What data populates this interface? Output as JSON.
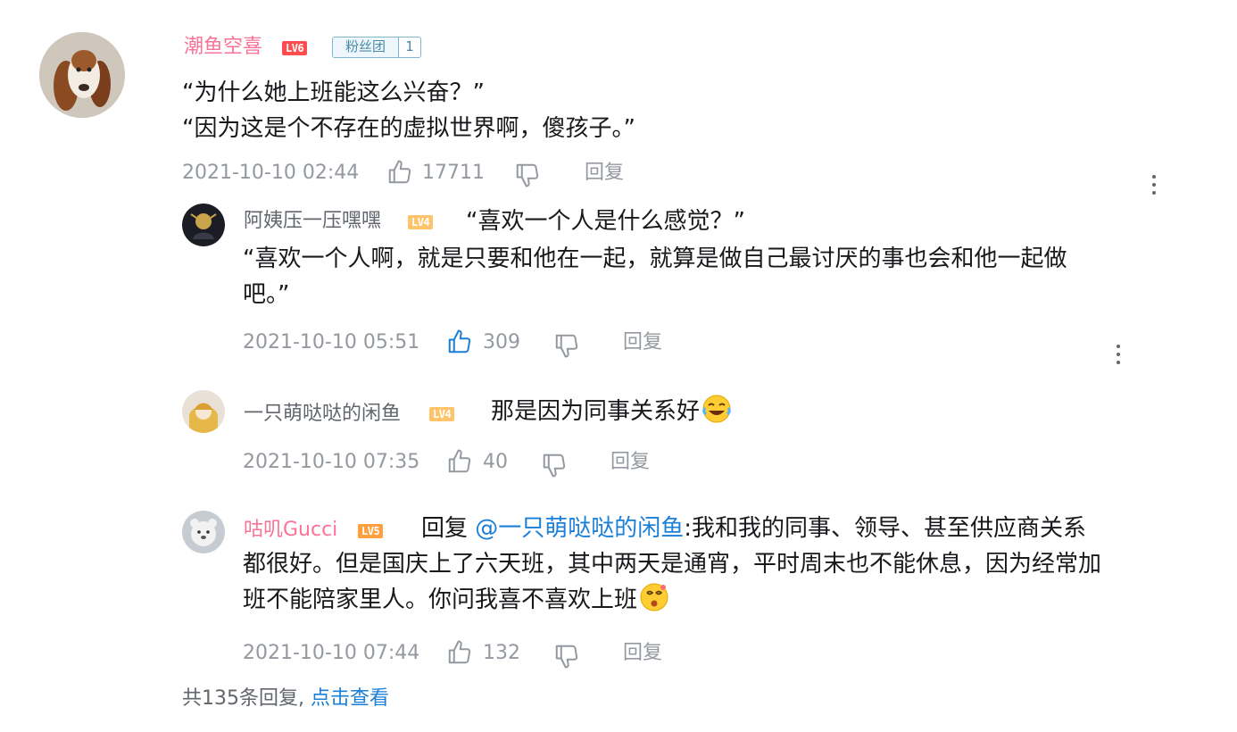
{
  "main_comment": {
    "username": "潮鱼空喜",
    "level": "LV6",
    "fan_badge": {
      "name": "粉丝团",
      "level": "1"
    },
    "lines": [
      "“为什么她上班能这么兴奋？”",
      "“因为这是个不存在的虚拟世界啊，傻孩子。”"
    ],
    "date": "2021-10-10 02:44",
    "likes": "17711",
    "reply_label": "回复"
  },
  "replies": [
    {
      "username": "阿姨压一压嘿嘿",
      "level": "LV4",
      "lines": [
        "“喜欢一个人是什么感觉？”",
        "“喜欢一个人啊，就是只要和他在一起，就算是做自己最讨厌的事也会和他一起做",
        "吧。”"
      ],
      "date": "2021-10-10 05:51",
      "likes": "309",
      "liked": true,
      "reply_label": "回复"
    },
    {
      "username": "一只萌哒哒的闲鱼",
      "level": "LV4",
      "lines": [
        "那是因为同事关系好"
      ],
      "emoji": "laughing-tears-emoji",
      "date": "2021-10-10 07:35",
      "likes": "40",
      "liked": false,
      "reply_label": "回复"
    },
    {
      "username": "咕叽Gucci",
      "level": "LV5",
      "reply_prefix": "回复",
      "mention": "@一只萌哒哒的闲鱼",
      "lines": [
        ":我和我的同事、领导、甚至供应商关系",
        "都很好。但是国庆上了六天班，其中两天是通宵，平时周末也不能休息，因为经常加",
        "班不能陪家里人。你问我喜不喜欢上班"
      ],
      "emoji": "dizzy-face-emoji",
      "date": "2021-10-10 07:44",
      "likes": "132",
      "liked": false,
      "reply_label": "回复"
    }
  ],
  "footer": {
    "summary": "共135条回复,",
    "view_more": "点击查看"
  },
  "icons": {
    "like": "thumbs-up-icon",
    "dislike": "thumbs-down-icon",
    "more": "more-vertical-icon"
  },
  "colors": {
    "username_pink": "#fb7299",
    "username_gray": "#61666d",
    "liked_blue": "#1a7fd6",
    "meta_gray": "#9499a0",
    "lv6": "#ff4d4f",
    "lv5": "#ff9f3d",
    "lv4": "#ffc46b"
  }
}
